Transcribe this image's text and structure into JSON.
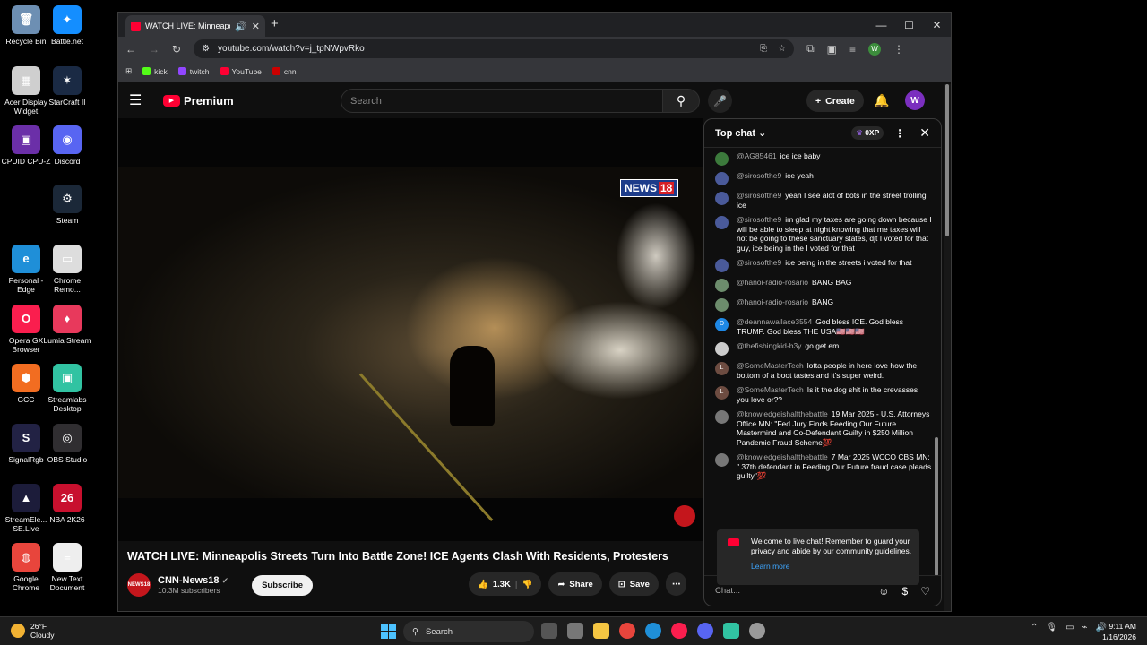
{
  "desktop": {
    "icons": [
      {
        "label": "Recycle Bin",
        "color": "#6d8fb3",
        "glyph": "🗑"
      },
      {
        "label": "Battle.net",
        "color": "#148eff",
        "glyph": "✦"
      },
      {
        "label": "Acer Display Widget",
        "color": "#cfcfcf",
        "glyph": "▦"
      },
      {
        "label": "StarCraft II",
        "color": "#1a2a44",
        "glyph": "✶"
      },
      {
        "label": "CPUID CPU-Z",
        "color": "#6b2fa8",
        "glyph": "▣"
      },
      {
        "label": "Discord",
        "color": "#5865f2",
        "glyph": "◉"
      },
      {
        "label": "Steam",
        "color": "#1b2838",
        "glyph": "⚙"
      },
      {
        "label": "Personal - Edge",
        "color": "#1f8fd8",
        "glyph": "e"
      },
      {
        "label": "Chrome Remo...",
        "color": "#dddddd",
        "glyph": "▭"
      },
      {
        "label": "Opera GX Browser",
        "color": "#fa1e4e",
        "glyph": "O"
      },
      {
        "label": "Lumia Stream",
        "color": "#e8395c",
        "glyph": "♦"
      },
      {
        "label": "GCC",
        "color": "#f26d21",
        "glyph": "⬢"
      },
      {
        "label": "Streamlabs Desktop",
        "color": "#31c3a2",
        "glyph": "▣"
      },
      {
        "label": "SignalRgb",
        "color": "#222244",
        "glyph": "S"
      },
      {
        "label": "OBS Studio",
        "color": "#302e31",
        "glyph": "◎"
      },
      {
        "label": "StreamEle... SE.Live",
        "color": "#1c1c3a",
        "glyph": "▲"
      },
      {
        "label": "NBA 2K26",
        "color": "#c8102e",
        "glyph": "26"
      },
      {
        "label": "Google Chrome",
        "color": "#e8453c",
        "glyph": "◍"
      },
      {
        "label": "New Text Document",
        "color": "#eeeeee",
        "glyph": "≡"
      }
    ]
  },
  "browser": {
    "tab_title": "WATCH LIVE: Minneapolis S",
    "url": "youtube.com/watch?v=j_tpNWpvRko",
    "profile_initial": "W",
    "bookmarks": [
      {
        "label": "kick",
        "color": "#53fc18"
      },
      {
        "label": "twitch",
        "color": "#9146ff"
      },
      {
        "label": "YouTube",
        "color": "#ff0033"
      },
      {
        "label": "cnn",
        "color": "#cc0000"
      }
    ]
  },
  "youtube": {
    "logo_text": "Premium",
    "search_placeholder": "Search",
    "create_label": "Create",
    "user_initial": "W",
    "video_title": "WATCH LIVE: Minneapolis Streets Turn Into Battle Zone! ICE Agents Clash With Residents, Protesters",
    "channel_name": "CNN-News18",
    "channel_avatar_text": "NEWS18",
    "subscribers": "10.3M subscribers",
    "subscribe_label": "Subscribe",
    "likes": "1.3K",
    "share_label": "Share",
    "save_label": "Save",
    "watermark": "NEWS",
    "watermark_num": "18"
  },
  "chat": {
    "header": "Top chat",
    "points": "0XP",
    "messages": [
      {
        "author": "@AG85461",
        "text": "ice ice baby",
        "avatar": "#3c7a3c",
        "initial": ""
      },
      {
        "author": "@sirosofthe9",
        "text": "ice yeah",
        "avatar": "#4a5a9a",
        "initial": ""
      },
      {
        "author": "@sirosofthe9",
        "text": "yeah I see alot of bots in the street trolling ice",
        "avatar": "#4a5a9a",
        "initial": ""
      },
      {
        "author": "@sirosofthe9",
        "text": "im glad my taxes are going down because I will be able to sleep at night knowing that me taxes will not be going to these sanctuary states, djt I voted for that guy, ice being in the I voted for that",
        "avatar": "#4a5a9a",
        "initial": ""
      },
      {
        "author": "@sirosofthe9",
        "text": "ice being in the streets i voted for that",
        "avatar": "#4a5a9a",
        "initial": ""
      },
      {
        "author": "@hanoi-radio-rosario",
        "text": "BANG BAG",
        "avatar": "#6c8c6c",
        "initial": ""
      },
      {
        "author": "@hanoi-radio-rosario",
        "text": "BANG",
        "avatar": "#6c8c6c",
        "initial": ""
      },
      {
        "author": "@deannawallace3554",
        "text": "God bless ICE. God bless TRUMP. God bless THE USA🇺🇸🇺🇸🇺🇸",
        "avatar": "#1e88e5",
        "initial": "D"
      },
      {
        "author": "@thefishingkid-b3y",
        "text": "go get em",
        "avatar": "#cccccc",
        "initial": ""
      },
      {
        "author": "@SomeMasterTech",
        "text": "lotta people in here love how the bottom of a boot tastes and it's super weird.",
        "avatar": "#6d4c41",
        "initial": "L"
      },
      {
        "author": "@SomeMasterTech",
        "text": "Is it the dog shit in the crevasses you love or??",
        "avatar": "#6d4c41",
        "initial": "L"
      },
      {
        "author": "@knowledgeishalfthebattle",
        "text": "19 Mar 2025 - U.S. Attorneys Office MN: \"Fed Jury Finds Feeding Our Future Mastermind and Co-Defendant Guilty in $250 Million Pandemic Fraud Scheme💯",
        "avatar": "#777777",
        "initial": ""
      },
      {
        "author": "@knowledgeishalfthebattle",
        "text": "7 Mar 2025 WCCO CBS MN: \" 37th defendant in Feeding Our Future fraud case pleads guilty\"💯",
        "avatar": "#777777",
        "initial": ""
      }
    ],
    "welcome": "Welcome to live chat! Remember to guard your privacy and abide by our community guidelines.",
    "learn_more": "Learn more",
    "input_placeholder": "Chat..."
  },
  "taskbar": {
    "temp": "26°F",
    "condition": "Cloudy",
    "search_label": "Search",
    "time": "9:11 AM",
    "date": "1/16/2026"
  }
}
